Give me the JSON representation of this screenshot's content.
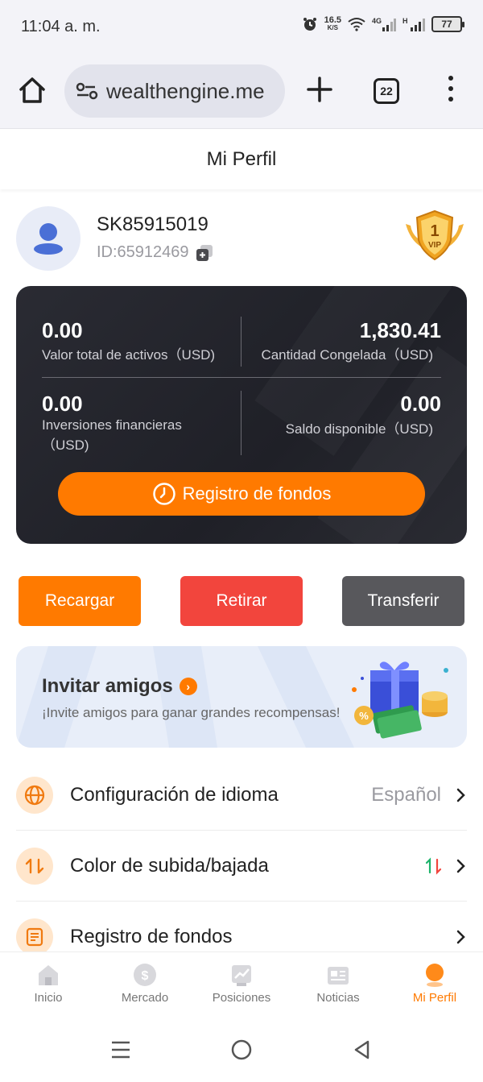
{
  "status": {
    "time": "11:04 a. m.",
    "net_speed": "16.5",
    "net_unit": "K/S",
    "battery": "77"
  },
  "browser": {
    "url": "wealthengine.me",
    "tab_count": "22"
  },
  "header": {
    "title": "Mi Perfil"
  },
  "profile": {
    "username": "SK85915019",
    "id": "ID:65912469",
    "vip_level": "1",
    "vip_label": "VIP"
  },
  "assets": {
    "total_value": "0.00",
    "total_label": "Valor total de activos（USD)",
    "frozen_value": "1,830.41",
    "frozen_label": "Cantidad Congelada（USD)",
    "investments_value": "0.00",
    "investments_label_1": "Inversiones financieras",
    "investments_label_2": "（USD)",
    "available_value": "0.00",
    "available_label": "Saldo disponible（USD)",
    "funds_button": "Registro de fondos"
  },
  "actions": {
    "recharge": "Recargar",
    "withdraw": "Retirar",
    "transfer": "Transferir"
  },
  "invite": {
    "title": "Invitar amigos",
    "subtitle": "¡Invite amigos para ganar grandes recompensas!"
  },
  "menu": {
    "language": {
      "label": "Configuración de idioma",
      "value": "Español"
    },
    "color": {
      "label": "Color de subida/bajada"
    },
    "funds": {
      "label": "Registro de fondos"
    }
  },
  "nav": {
    "home": "Inicio",
    "market": "Mercado",
    "positions": "Posiciones",
    "news": "Noticias",
    "profile": "Mi Perfil"
  },
  "colors": {
    "accent": "#ff7a00",
    "withdraw": "#f2453d",
    "transfer": "#58585c",
    "card": "#24252c"
  }
}
